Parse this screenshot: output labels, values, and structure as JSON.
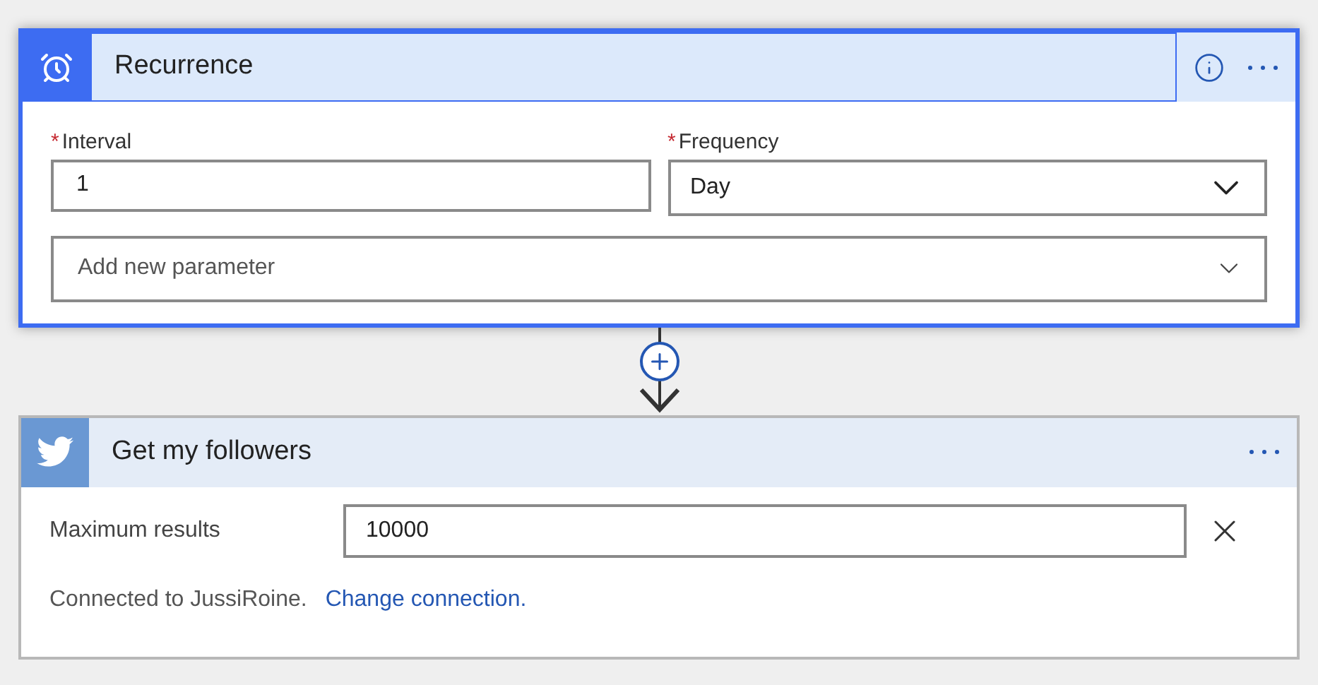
{
  "steps": [
    {
      "kind": "recurrence",
      "title": "Recurrence",
      "selected": true,
      "fields": [
        {
          "kind": "text",
          "required_mark": "*",
          "label": "Interval",
          "value": "1"
        },
        {
          "kind": "dropdown",
          "required_mark": "*",
          "label": "Frequency",
          "value": "Day"
        }
      ],
      "add_parameter": {
        "placeholder": "Add new parameter"
      }
    },
    {
      "kind": "twitter",
      "title": "Get my followers",
      "selected": false,
      "fields": [
        {
          "kind": "clearable",
          "label": "Maximum results",
          "value": "10000"
        }
      ],
      "connection": {
        "text": "Connected to JussiRoine.",
        "link": "Change connection."
      }
    }
  ]
}
